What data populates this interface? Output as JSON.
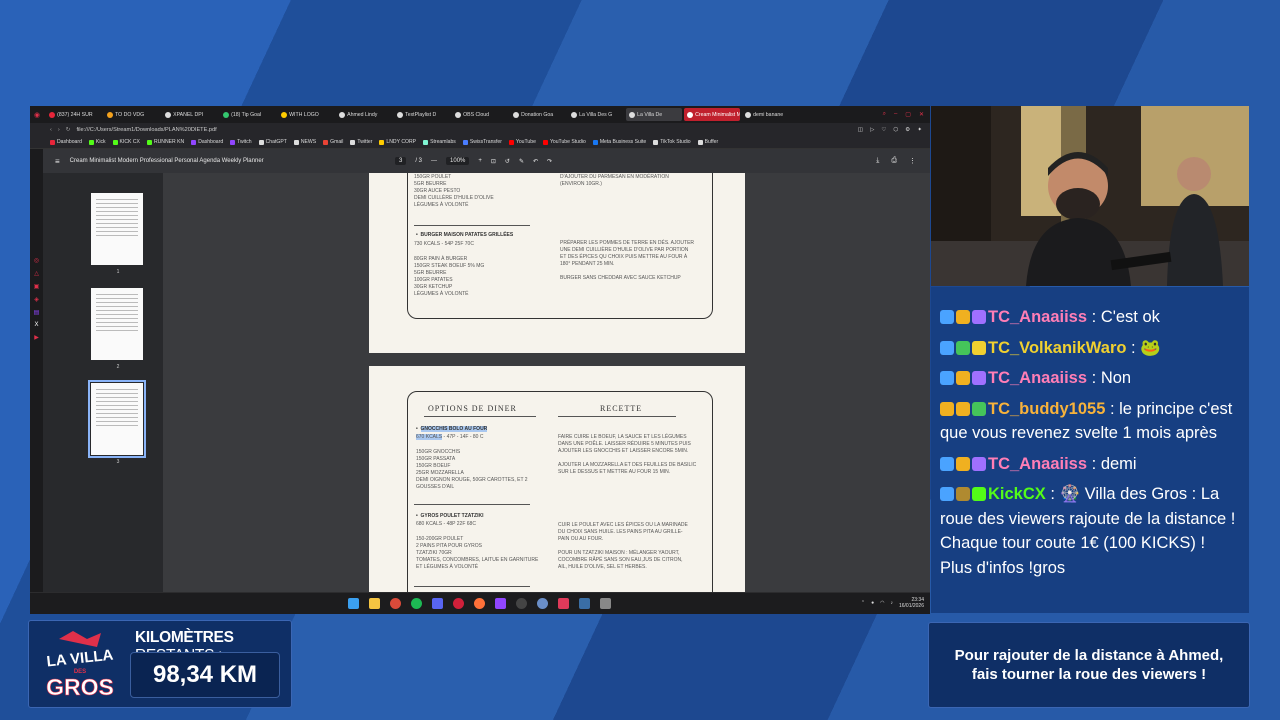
{
  "browser": {
    "tabs": [
      {
        "label": "(837) 24H SUR",
        "color": "#e8253a"
      },
      {
        "label": "TO DO VDG",
        "color": "#f4a21d"
      },
      {
        "label": "XPANEL DPI",
        "color": "#dddddd"
      },
      {
        "label": "(18) Tip Goal",
        "color": "#34c76f"
      },
      {
        "label": "WITH LOGO",
        "color": "#ffcc00"
      },
      {
        "label": "Ahmed Lindy",
        "color": "#dddddd"
      },
      {
        "label": "TextPlaylist D",
        "color": "#dddddd"
      },
      {
        "label": "OBS Cloud",
        "color": "#dddddd"
      },
      {
        "label": "Donation Goa",
        "color": "#dddddd"
      },
      {
        "label": "La Villa Des G",
        "color": "#dddddd"
      },
      {
        "label": "La Villa De",
        "color": "#dddddd"
      },
      {
        "label": "Cream Minimalist Mode",
        "color": "#ffffff"
      },
      {
        "label": "demi banane",
        "color": "#dddddd"
      }
    ],
    "address": "file:///C:/Users/Stream1/Downloads/PLAN%20DIETE.pdf",
    "bookmarks": [
      {
        "label": "Dashboard",
        "color": "#e8253a"
      },
      {
        "label": "Kick",
        "color": "#53fc18"
      },
      {
        "label": "KICK CX",
        "color": "#53fc18"
      },
      {
        "label": "RUNNER KN",
        "color": "#53fc18"
      },
      {
        "label": "Dashboard",
        "color": "#9146ff"
      },
      {
        "label": "Twitch",
        "color": "#9146ff"
      },
      {
        "label": "ChatGPT",
        "color": "#dddddd"
      },
      {
        "label": "NEWS",
        "color": "#dddddd"
      },
      {
        "label": "Gmail",
        "color": "#ea4335"
      },
      {
        "label": "Twitter",
        "color": "#dddddd"
      },
      {
        "label": "LNDY CORP",
        "color": "#ffcc00"
      },
      {
        "label": "Streamlabs",
        "color": "#80f5d2"
      },
      {
        "label": "SwissTransfer",
        "color": "#4a7dff"
      },
      {
        "label": "YouTube",
        "color": "#ff0000"
      },
      {
        "label": "YouTube Studio",
        "color": "#ff0000"
      },
      {
        "label": "Meta Business Suite",
        "color": "#1877f2"
      },
      {
        "label": "TikTok Studio",
        "color": "#dddddd"
      },
      {
        "label": "Buffer",
        "color": "#dddddd"
      }
    ]
  },
  "pdf": {
    "title": "Cream Minimalist Modern Professional Personal Agenda Weekly Planner",
    "page_current": "3",
    "page_total": "/ 3",
    "zoom": "100%",
    "thumb_labels": [
      "1",
      "2",
      "3"
    ],
    "top_card": {
      "left_lines": "150GR POULET\n5GR BEURRE\n30GR AUCE PESTO\nDEMI CUILLÈRE D'HUILE D'OLIVE\nLÉGUMES À VOLONTÉ",
      "right_lines": "D'AJOUTER DU PARMESAN EN MODÉRATION\n(ENVIRON 10GR.)",
      "dish2_title": "BURGER MAISON PATATES GRILLÉES",
      "dish2_kcal": "730 KCALS - 54P 25F 70C",
      "dish2_lines": "80GR PAIN À BURGER\n150GR STEAK BOEUF 5% MG\n5GR BEURRE\n100GR PATATES\n30GR KETCHUP\nLÉGUMES À VOLONTÉ",
      "dish2_recipe": "PRÉPARER LES POMMES DE TERRE EN DÉS. AJOUTER\nUNE DEMI CUILLIÈRE D'HUILE D'OLIVE PAR PORTION\nET DES ÉPICES QU CHOIX PUIS METTRE AU FOUR À\n180° PENDANT 25 MIN.\n\nBURGER SANS CHEDDAR AVEC SAUCE KETCHUP"
    },
    "bottom_card": {
      "heading_left": "OPTIONS DE DINER",
      "heading_right": "RECETTE",
      "dish1_title": "GNOCCHIS BOLO AU FOUR",
      "dish1_kcal": "670 KCALS",
      "dish1_macros": " - 47P - 14F - 80 C",
      "dish1_lines": "150GR GNOCCHIS\n150GR PASSATA\n150GR BOEUF\n25GR MOZZARELLA\nDEMI OIGNON ROUGE, 50GR CAROTTES, ET 2\nGOUSSES D'AIL",
      "dish1_recipe": "FAIRE CUIRE LE BOEUF, LA SAUCE ET LES LÉGUMES\nDANS UNE POÊLE. LAISSER RÉDUIRE 5 MINUTES PUIS\nAJOUTER LES GNOCCHIS ET LAISSER ENCORE 5MIN.\n\nAJOUTER LA MOZZARELLA ET DES FEUILLES DE BASILIC\nSUR LE DESSUS ET METTRE AU FOUR 15 MIN.",
      "dish2_title": "GYROS POULET TZATZIKI",
      "dish2_kcal": "680 KCALS - 48P 22F 68C",
      "dish2_lines": "150-200GR POULET\n2 PAINS PITA POUR GYROS\nTZATZIKI 70GR\nTOMATES, CONCOMBRES, LAITUE EN GARNITURE\nET LÉGUMES À VOLONTÉ",
      "dish2_recipe": "CUIR LE POULET AVEC LES ÉPICES OU LA MARINADE\nDU CHOIX SANS HUILE. LES PAINS PITA AU GRILLE-\nPAIN OU AU FOUR.\n\nPOUR UN TZATZIKI MAISON : MÉLANGER YAOURT,\nCOCOMBRE RÂPÉ SANS SON EAU,JUS DE CITRON,\nAIL, HUILE D'OLIVE, SEL ET HERBES."
    }
  },
  "taskbar": {
    "time": "23:34",
    "date": "16/01/2026"
  },
  "chat": [
    {
      "user": "TC_Anaaiiss",
      "color": "#ff7eb6",
      "text": "C'est ok"
    },
    {
      "user": "TC_VolkanikWaro",
      "color": "#f0d030",
      "text": "🐸"
    },
    {
      "user": "TC_Anaaiiss",
      "color": "#ff7eb6",
      "text": "Non"
    },
    {
      "user": "TC_buddy1055",
      "color": "#f7b23b",
      "text": "le principe c'est que vous revenez svelte 1 mois après"
    },
    {
      "user": "TC_Anaaiiss",
      "color": "#ff7eb6",
      "text": "demi"
    },
    {
      "user": "KickCX",
      "color": "#53fc18",
      "text": "🎡 Villa des Gros : La roue des viewers rajoute de la distance ! Chaque tour coute 1€ (100 KICKS) ! Plus d'infos !gros"
    }
  ],
  "overlay": {
    "km_title_bold": "KILOMÈTRES",
    "km_title_rest": " RESTANTS :",
    "km_value": "98,34 KM",
    "logo_top": "LA VILLA",
    "logo_mid": "DES",
    "logo_bottom": "GROS",
    "info": "Pour rajouter de la distance à Ahmed, fais tourner la roue des viewers !"
  },
  "colors": {
    "accent": "#1f4f9a",
    "panel": "#0f2f66"
  }
}
